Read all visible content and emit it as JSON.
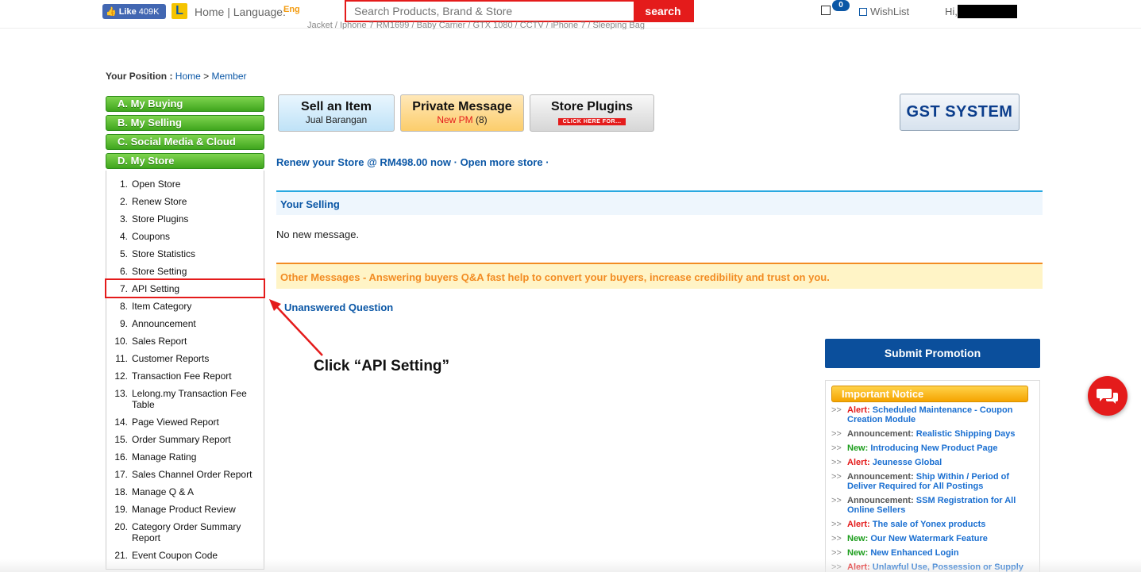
{
  "topbar": {
    "fb_like_label": "Like",
    "fb_like_count": "409K",
    "logo_letter": "L",
    "home_language": "Home | Language:",
    "lang": "Eng",
    "search_placeholder": "Search Products, Brand & Store",
    "search_button": "search",
    "marquee": "Jacket / Iphone 7 RM1699 / Baby Carrier / GTX 1080 / CCTV / iPhone 7 / Sleeping Bag",
    "cart_count": "0",
    "wishlist": "WishList",
    "hi": "Hi,"
  },
  "breadcrumb": {
    "label": "Your Position :",
    "home": "Home",
    "sep": ">",
    "member": "Member"
  },
  "sidebar": {
    "sections": [
      {
        "label": "A. My Buying"
      },
      {
        "label": "B. My Selling"
      },
      {
        "label": "C. Social Media & Cloud"
      },
      {
        "label": "D. My Store"
      }
    ],
    "items": [
      {
        "num": "1.",
        "label": "Open Store"
      },
      {
        "num": "2.",
        "label": "Renew Store"
      },
      {
        "num": "3.",
        "label": "Store Plugins"
      },
      {
        "num": "4.",
        "label": "Coupons"
      },
      {
        "num": "5.",
        "label": "Store Statistics"
      },
      {
        "num": "6.",
        "label": "Store Setting"
      },
      {
        "num": "7.",
        "label": "API Setting"
      },
      {
        "num": "8.",
        "label": "Item Category"
      },
      {
        "num": "9.",
        "label": "Announcement"
      },
      {
        "num": "10.",
        "label": "Sales Report"
      },
      {
        "num": "11.",
        "label": "Customer Reports"
      },
      {
        "num": "12.",
        "label": "Transaction Fee Report"
      },
      {
        "num": "13.",
        "label": "Lelong.my Transaction Fee Table"
      },
      {
        "num": "14.",
        "label": "Page Viewed Report"
      },
      {
        "num": "15.",
        "label": "Order Summary Report"
      },
      {
        "num": "16.",
        "label": "Manage Rating"
      },
      {
        "num": "17.",
        "label": "Sales Channel Order Report"
      },
      {
        "num": "18.",
        "label": "Manage Q & A"
      },
      {
        "num": "19.",
        "label": "Manage Product Review"
      },
      {
        "num": "20.",
        "label": "Category Order Summary Report"
      },
      {
        "num": "21.",
        "label": "Event Coupon Code"
      }
    ]
  },
  "actions": {
    "sell_title": "Sell an Item",
    "sell_sub": "Jual Barangan",
    "pm_title": "Private Message",
    "pm_new": "New PM",
    "pm_count": "(8)",
    "plugins_title": "Store Plugins",
    "plugins_click": "CLICK HERE FOR...",
    "gst": "GST SYSTEM"
  },
  "main": {
    "renew": "Renew your Store @ RM498.00 now · Open more store ·",
    "your_selling": "Your Selling",
    "no_message": "No new message.",
    "other_messages": "Other Messages - Answering buyers Q&A fast help to convert your buyers, increase credibility and trust on you.",
    "unanswered": "Unanswered Question"
  },
  "annotation": {
    "text": "Click “API Setting”"
  },
  "right": {
    "submit_promotion": "Submit Promotion",
    "notice_title": "Important Notice",
    "notices": [
      {
        "tag": "Alert:",
        "type": "alert",
        "text": "Scheduled Maintenance - Coupon Creation Module"
      },
      {
        "tag": "Announcement:",
        "type": "ann",
        "text": "Realistic Shipping Days"
      },
      {
        "tag": "New:",
        "type": "new",
        "text": "Introducing New Product Page"
      },
      {
        "tag": "Alert:",
        "type": "alert",
        "text": "Jeunesse Global"
      },
      {
        "tag": "Announcement:",
        "type": "ann",
        "text": "Ship Within / Period of Deliver Required for All Postings"
      },
      {
        "tag": "Announcement:",
        "type": "ann",
        "text": "SSM Registration for All Online Sellers"
      },
      {
        "tag": "Alert:",
        "type": "alert",
        "text": "The sale of Yonex products"
      },
      {
        "tag": "New:",
        "type": "new",
        "text": "Our New Watermark Feature"
      },
      {
        "tag": "New:",
        "type": "new",
        "text": "New Enhanced Login"
      },
      {
        "tag": "Alert:",
        "type": "alert",
        "text": "Unlawful Use, Possession or Supply"
      }
    ]
  },
  "colors": {
    "accent_red": "#e41b1b",
    "link_blue": "#0b57a6",
    "menu_green": "#3fa51d",
    "notice_orange": "#f28c23"
  }
}
